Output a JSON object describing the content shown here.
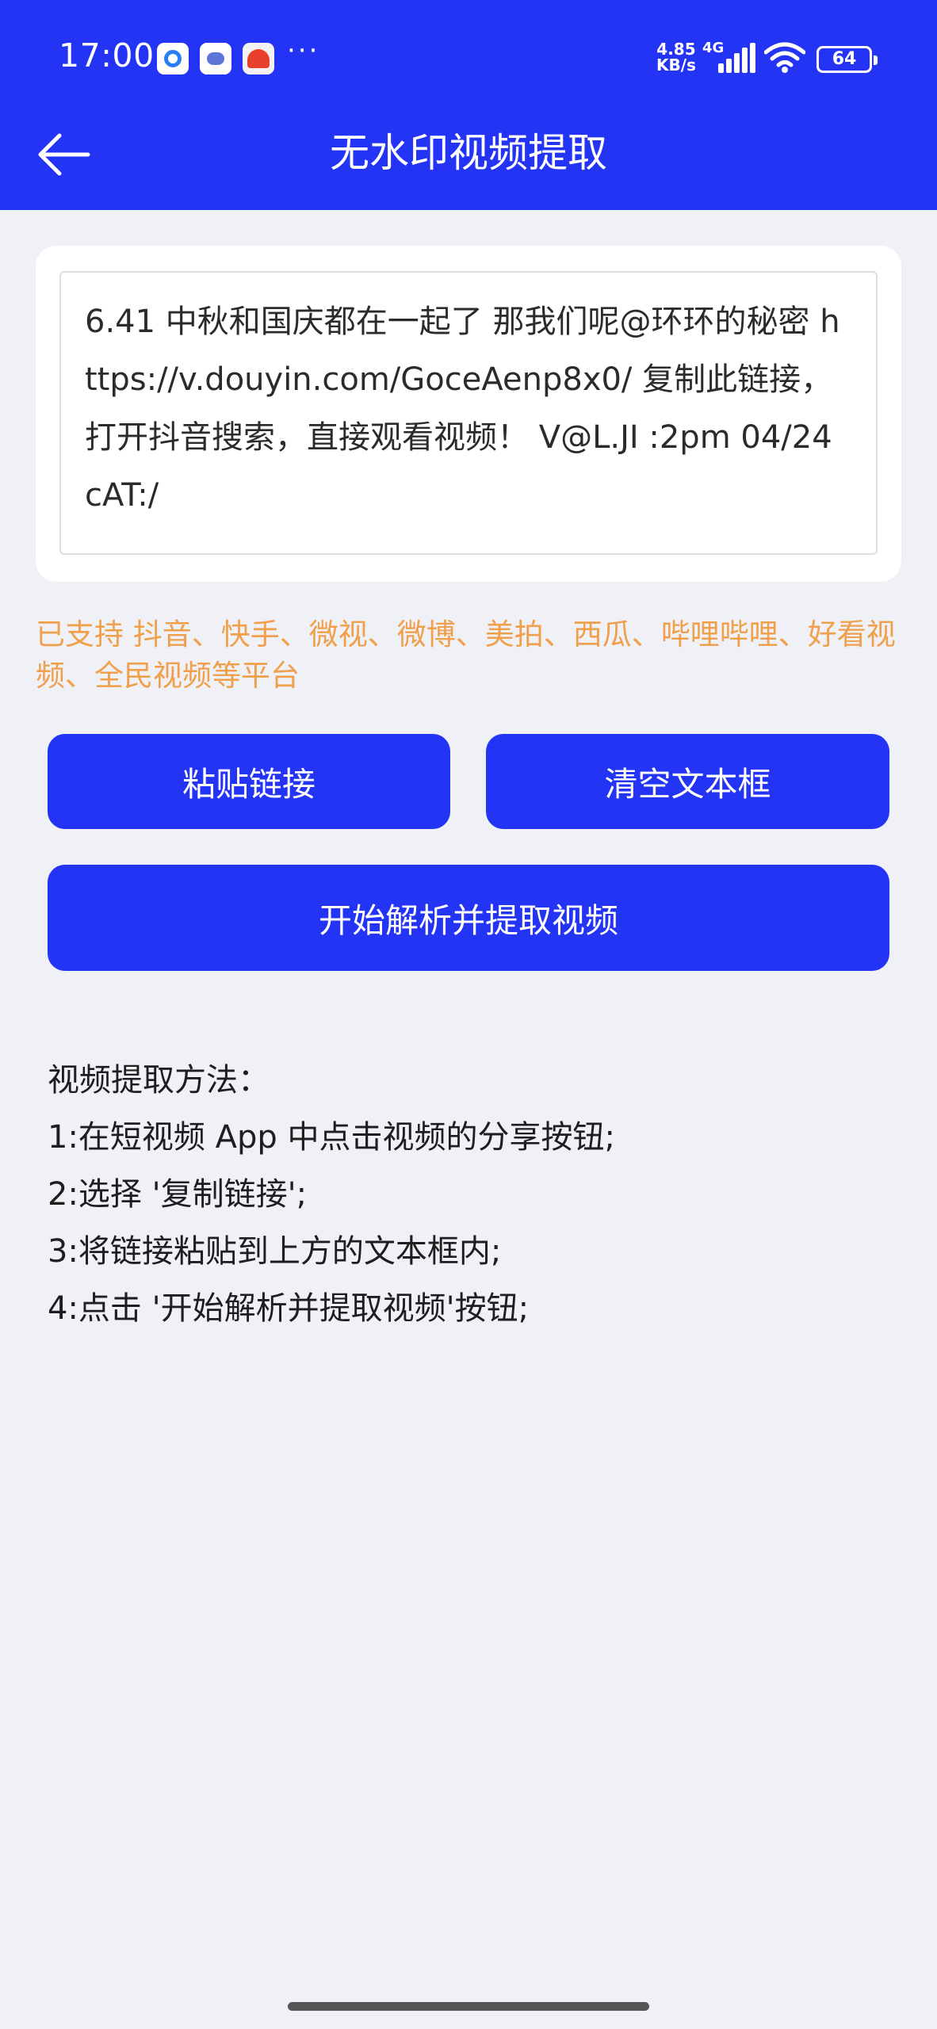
{
  "status_bar": {
    "time": "17:00",
    "more": "···",
    "net_speed_value": "4.85",
    "net_speed_unit": "KB/s",
    "net_type": "4G",
    "battery": "64"
  },
  "header": {
    "title": "无水印视频提取",
    "back_icon": "arrow-left-icon"
  },
  "input": {
    "value": "6.41 中秋和国庆都在一起了 那我们呢@环环的秘密 https://v.douyin.com/GoceAenp8x0/ 复制此链接，打开抖音搜索，直接观看视频！ V@L.JI :2pm 04/24 cAT:/"
  },
  "support_text": "已支持 抖音、快手、微视、微博、美拍、西瓜、哔哩哔哩、好看视频、全民视频等平台",
  "buttons": {
    "paste": "粘贴链接",
    "clear": "清空文本框",
    "parse": "开始解析并提取视频"
  },
  "instructions": {
    "title": "视频提取方法：",
    "steps": [
      "1:在短视频 App 中点击视频的分享按钮;",
      "2:选择 '复制链接';",
      "3:将链接粘贴到上方的文本框内;",
      "4:点击 '开始解析并提取视频'按钮;"
    ]
  },
  "colors": {
    "primary": "#2334f5",
    "support_text": "#f0a04a",
    "background": "#f0f0f7"
  }
}
